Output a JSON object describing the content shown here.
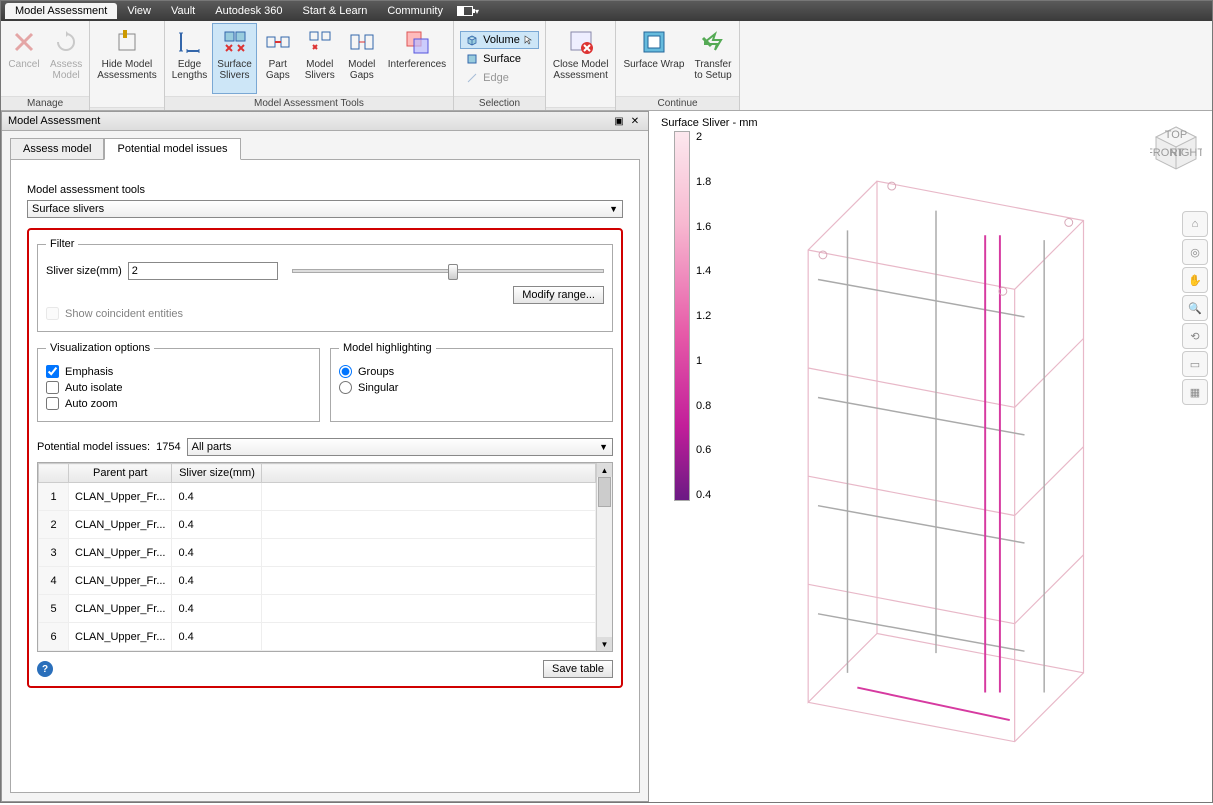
{
  "menubar": {
    "items": [
      "Model Assessment",
      "View",
      "Vault",
      "Autodesk 360",
      "Start & Learn",
      "Community"
    ],
    "active": 0
  },
  "ribbon": {
    "groups": [
      {
        "label": "Manage",
        "buttons": [
          {
            "name": "cancel",
            "label": "Cancel",
            "disabled": true,
            "icon": "x"
          },
          {
            "name": "assess-model",
            "label": "Assess\nModel",
            "disabled": true,
            "icon": "refresh"
          }
        ]
      },
      {
        "label": "",
        "buttons": [
          {
            "name": "hide-model-assessments",
            "label": "Hide Model\nAssessments",
            "icon": "hide"
          }
        ]
      },
      {
        "label": "Model Assessment Tools",
        "buttons": [
          {
            "name": "edge-lengths",
            "label": "Edge\nLengths",
            "icon": "edge"
          },
          {
            "name": "surface-slivers",
            "label": "Surface\nSlivers",
            "icon": "sliver",
            "active": true
          },
          {
            "name": "part-gaps",
            "label": "Part\nGaps",
            "icon": "pgap"
          },
          {
            "name": "model-slivers",
            "label": "Model\nSlivers",
            "icon": "msliver"
          },
          {
            "name": "model-gaps",
            "label": "Model\nGaps",
            "icon": "mgap"
          },
          {
            "name": "interferences",
            "label": "Interferences",
            "icon": "interf"
          }
        ]
      },
      {
        "label": "Selection",
        "selection": [
          {
            "name": "volume",
            "label": "Volume",
            "active": true,
            "icon": "cube"
          },
          {
            "name": "surface",
            "label": "Surface",
            "icon": "surf"
          },
          {
            "name": "edge",
            "label": "Edge",
            "disabled": true,
            "icon": "edgeln"
          }
        ]
      },
      {
        "label": "",
        "buttons": [
          {
            "name": "close-model-assessment",
            "label": "Close Model\nAssessment",
            "icon": "close"
          }
        ]
      },
      {
        "label": "Continue",
        "buttons": [
          {
            "name": "surface-wrap",
            "label": "Surface Wrap",
            "icon": "wrap"
          },
          {
            "name": "transfer-to-setup",
            "label": "Transfer\nto Setup",
            "icon": "transfer"
          }
        ]
      }
    ]
  },
  "panel": {
    "title": "Model Assessment",
    "tabs": [
      "Assess model",
      "Potential model issues"
    ],
    "active_tab": 1,
    "tools_label": "Model assessment tools",
    "tools_value": "Surface slivers",
    "filter": {
      "legend": "Filter",
      "size_label": "Sliver size(mm)",
      "size_value": "2",
      "modify_btn": "Modify range...",
      "coincident": "Show coincident entities"
    },
    "viz": {
      "legend": "Visualization options",
      "emphasis": "Emphasis",
      "auto_isolate": "Auto isolate",
      "auto_zoom": "Auto zoom"
    },
    "highlight": {
      "legend": "Model highlighting",
      "groups": "Groups",
      "singular": "Singular"
    },
    "issues": {
      "label": "Potential model issues:",
      "count": "1754",
      "scope": "All parts",
      "columns": [
        "",
        "Parent part",
        "Sliver size(mm)"
      ],
      "rows": [
        {
          "idx": "1",
          "part": "CLAN_Upper_Fr...",
          "size": "0.4"
        },
        {
          "idx": "2",
          "part": "CLAN_Upper_Fr...",
          "size": "0.4"
        },
        {
          "idx": "3",
          "part": "CLAN_Upper_Fr...",
          "size": "0.4"
        },
        {
          "idx": "4",
          "part": "CLAN_Upper_Fr...",
          "size": "0.4"
        },
        {
          "idx": "5",
          "part": "CLAN_Upper_Fr...",
          "size": "0.4"
        },
        {
          "idx": "6",
          "part": "CLAN_Upper_Fr...",
          "size": "0.4"
        }
      ],
      "save_btn": "Save table"
    }
  },
  "viewport": {
    "legend_title": "Surface Sliver - mm",
    "ticks": [
      "2",
      "1.8",
      "1.6",
      "1.4",
      "1.2",
      "1",
      "0.8",
      "0.6",
      "0.4"
    ],
    "cube": {
      "top": "TOP",
      "front": "FRONT",
      "right": "RIGHT"
    }
  }
}
